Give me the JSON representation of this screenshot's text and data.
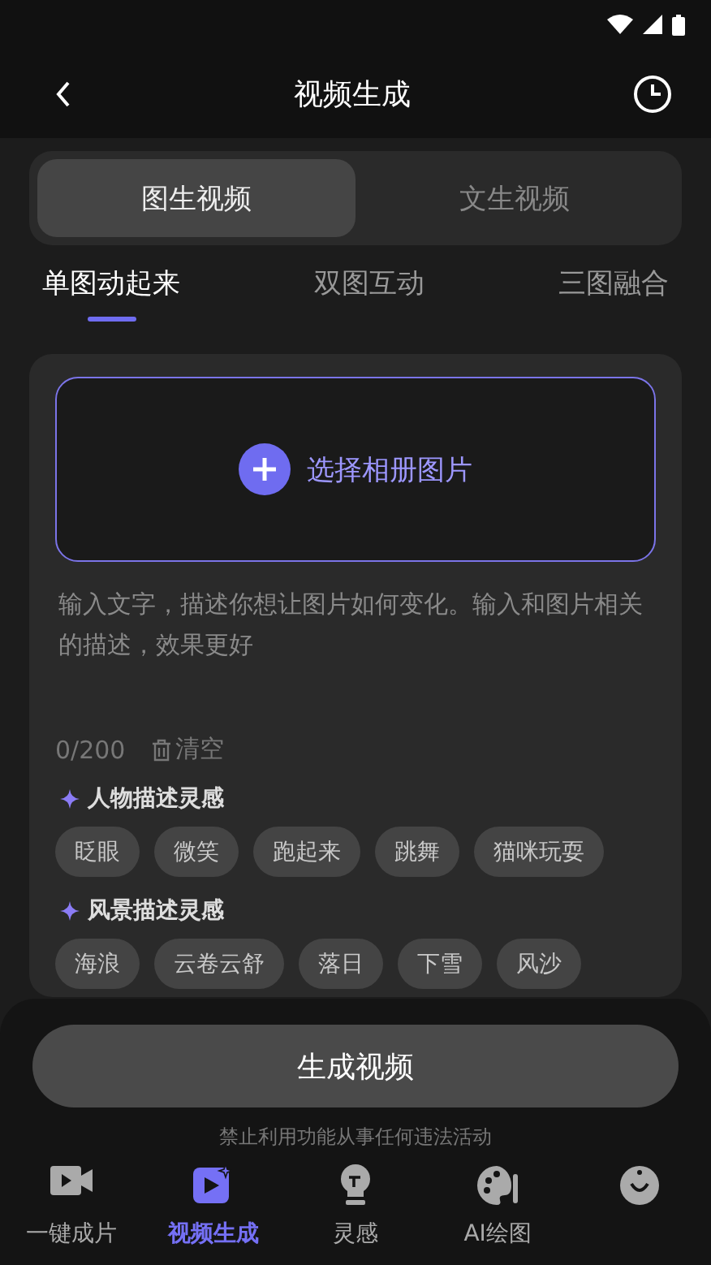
{
  "header": {
    "title": "视频生成"
  },
  "mode_tabs": [
    {
      "label": "图生视频",
      "selected": true
    },
    {
      "label": "文生视频",
      "selected": false
    }
  ],
  "sub_tabs": [
    {
      "label": "单图动起来",
      "selected": true
    },
    {
      "label": "双图互动",
      "selected": false
    },
    {
      "label": "三图融合",
      "selected": false
    }
  ],
  "upload": {
    "label": "选择相册图片"
  },
  "prompt": {
    "placeholder": "输入文字，描述你想让图片如何变化。输入和图片相关的描述，效果更好",
    "count": "0/200",
    "clear": "清空"
  },
  "inspirations": [
    {
      "title": "人物描述灵感",
      "chips": [
        "眨眼",
        "微笑",
        "跑起来",
        "跳舞",
        "猫咪玩耍"
      ]
    },
    {
      "title": "风景描述灵感",
      "chips": [
        "海浪",
        "云卷云舒",
        "落日",
        "下雪",
        "风沙"
      ]
    }
  ],
  "generate_button": "生成视频",
  "disclaimer": "禁止利用功能从事任何违法活动",
  "nav": [
    {
      "kind": "camera",
      "label": "一键成片",
      "selected": false
    },
    {
      "kind": "video",
      "label": "视频生成",
      "selected": true
    },
    {
      "kind": "bulb",
      "label": "灵感",
      "selected": false
    },
    {
      "kind": "palette",
      "label": "AI绘图",
      "selected": false
    },
    {
      "kind": "face",
      "selected": false
    }
  ]
}
